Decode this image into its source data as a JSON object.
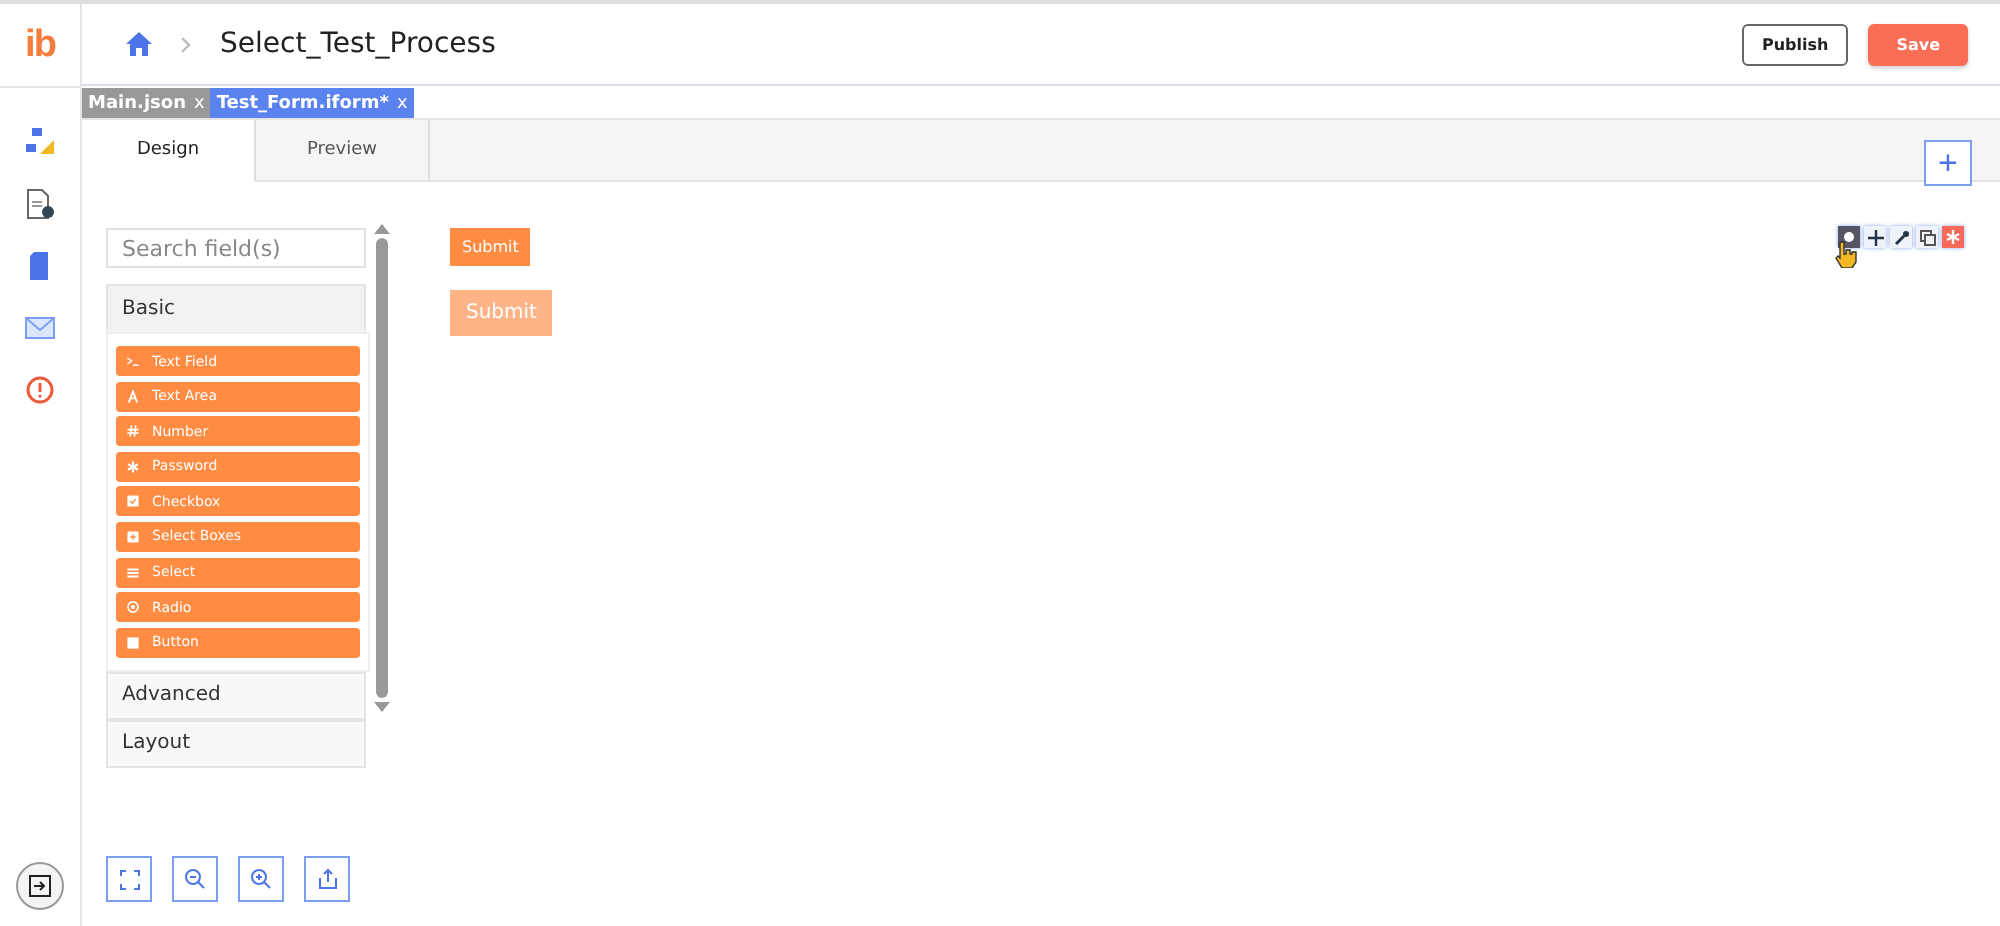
{
  "logo": "ib",
  "breadcrumb": {
    "title": "Select_Test_Process"
  },
  "header_buttons": [
    {
      "label": "Publish",
      "kind": "outline"
    },
    {
      "label": "Save",
      "kind": "primary"
    }
  ],
  "file_tabs": [
    {
      "label": "Main.json",
      "close": "x",
      "selected": false
    },
    {
      "label": "Test_Form.iform*",
      "close": "x",
      "selected": true
    }
  ],
  "view_tabs": [
    {
      "label": "Design",
      "selected": true
    },
    {
      "label": "Preview",
      "selected": false
    }
  ],
  "add_button": "+",
  "search": {
    "placeholder": "Search field(s)"
  },
  "groups": [
    {
      "label": "Basic",
      "expanded": true,
      "items": [
        {
          "label": "Text Field",
          "kind": "terminal"
        },
        {
          "label": "Text Area",
          "kind": "font"
        },
        {
          "label": "Number",
          "kind": "hash"
        },
        {
          "label": "Password",
          "kind": "asterisk"
        },
        {
          "label": "Checkbox",
          "kind": "check"
        },
        {
          "label": "Select Boxes",
          "kind": "plus"
        },
        {
          "label": "Select",
          "kind": "list"
        },
        {
          "label": "Radio",
          "kind": "radio"
        },
        {
          "label": "Button",
          "kind": "square"
        }
      ]
    },
    {
      "label": "Advanced",
      "expanded": false
    },
    {
      "label": "Layout",
      "expanded": false
    }
  ],
  "canvas": {
    "components": [
      {
        "label": "Submit",
        "kind": "small"
      },
      {
        "label": "Submit",
        "kind": "ghost"
      }
    ]
  }
}
